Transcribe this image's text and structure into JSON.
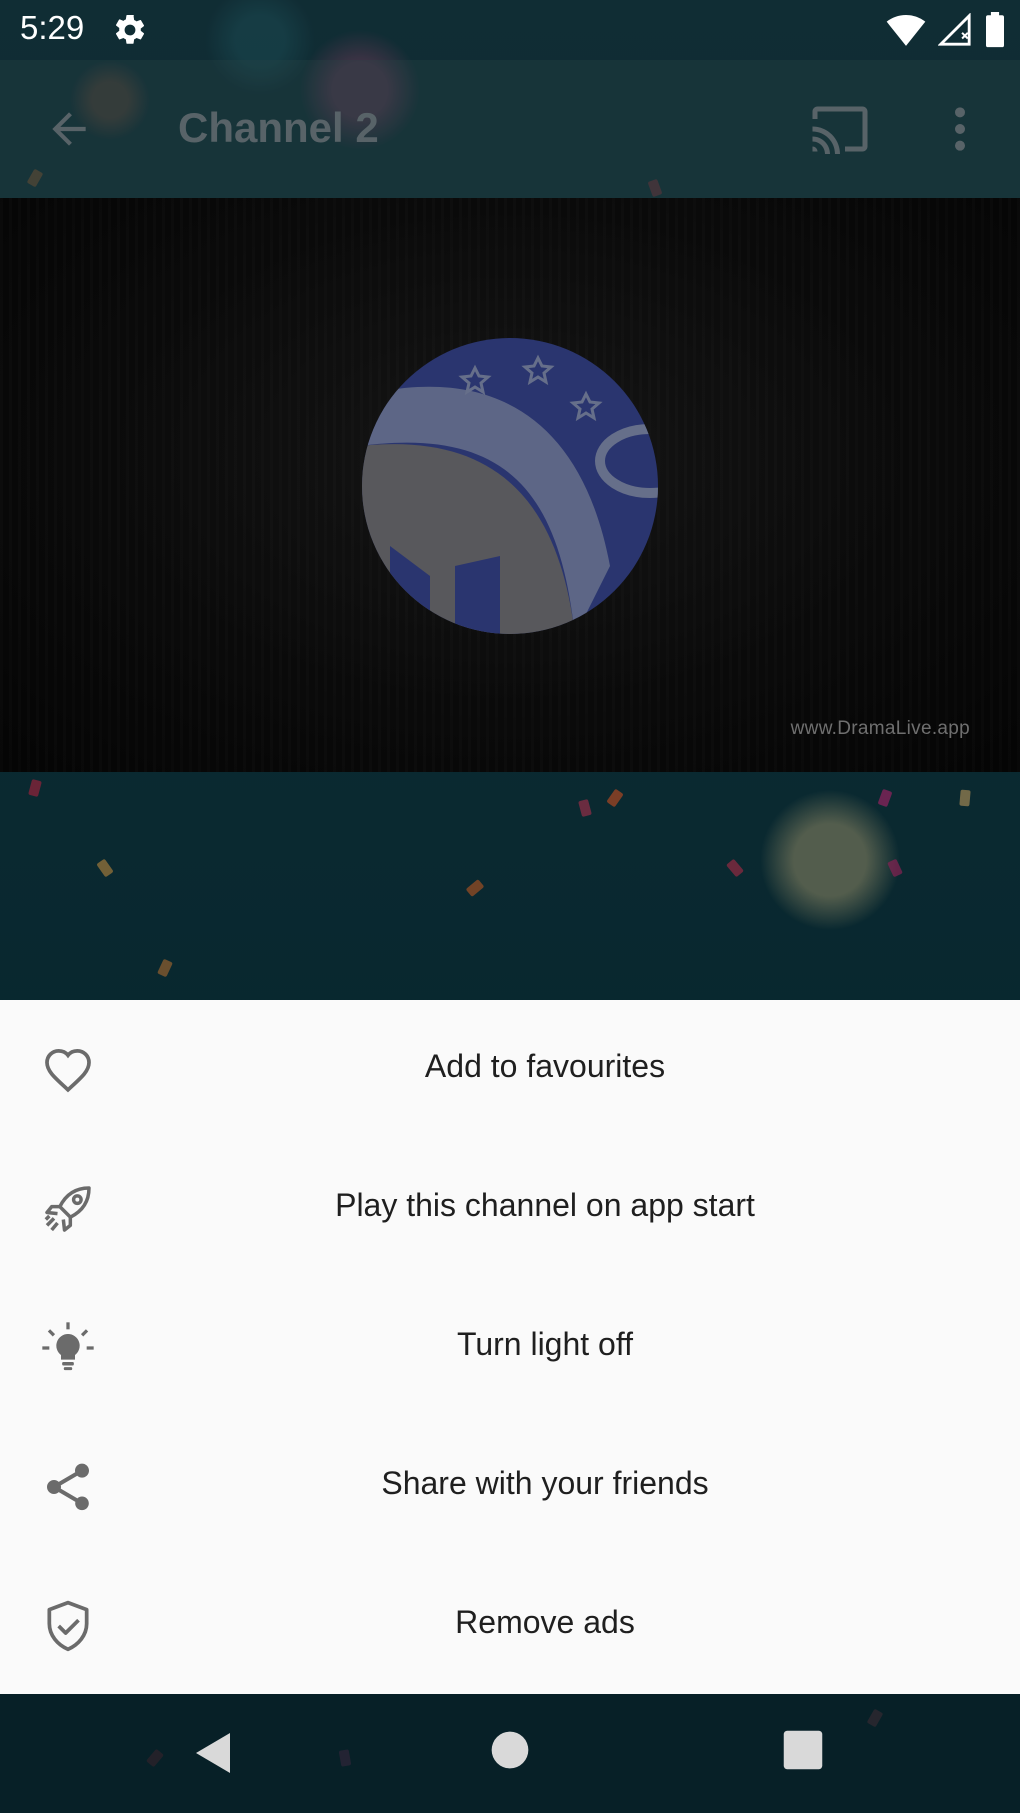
{
  "status_bar": {
    "time": "5:29",
    "icons": [
      "gear-icon",
      "wifi-icon",
      "signal-icon",
      "battery-icon"
    ]
  },
  "toolbar": {
    "title": "Channel 2",
    "icons": [
      "back-arrow-icon",
      "cast-icon",
      "more-vert-icon"
    ]
  },
  "player": {
    "watermark": "www.DramaLive.app"
  },
  "bottom_sheet": {
    "items": [
      {
        "label": "Add to favourites",
        "icon": "heart-icon"
      },
      {
        "label": "Play this channel on app start",
        "icon": "rocket-icon"
      },
      {
        "label": "Turn light off",
        "icon": "lightbulb-icon"
      },
      {
        "label": "Share with your friends",
        "icon": "share-icon"
      },
      {
        "label": "Remove ads",
        "icon": "shield-check-icon"
      }
    ]
  },
  "nav_bar": {
    "icons": [
      "nav-back-icon",
      "nav-home-icon",
      "nav-recents-icon"
    ]
  },
  "colors": {
    "sheet_background": "#fafafa",
    "sheet_text": "#1f1f1f",
    "icon_gray": "#6b6b6b",
    "logo_blue": "#3b4a9a"
  }
}
